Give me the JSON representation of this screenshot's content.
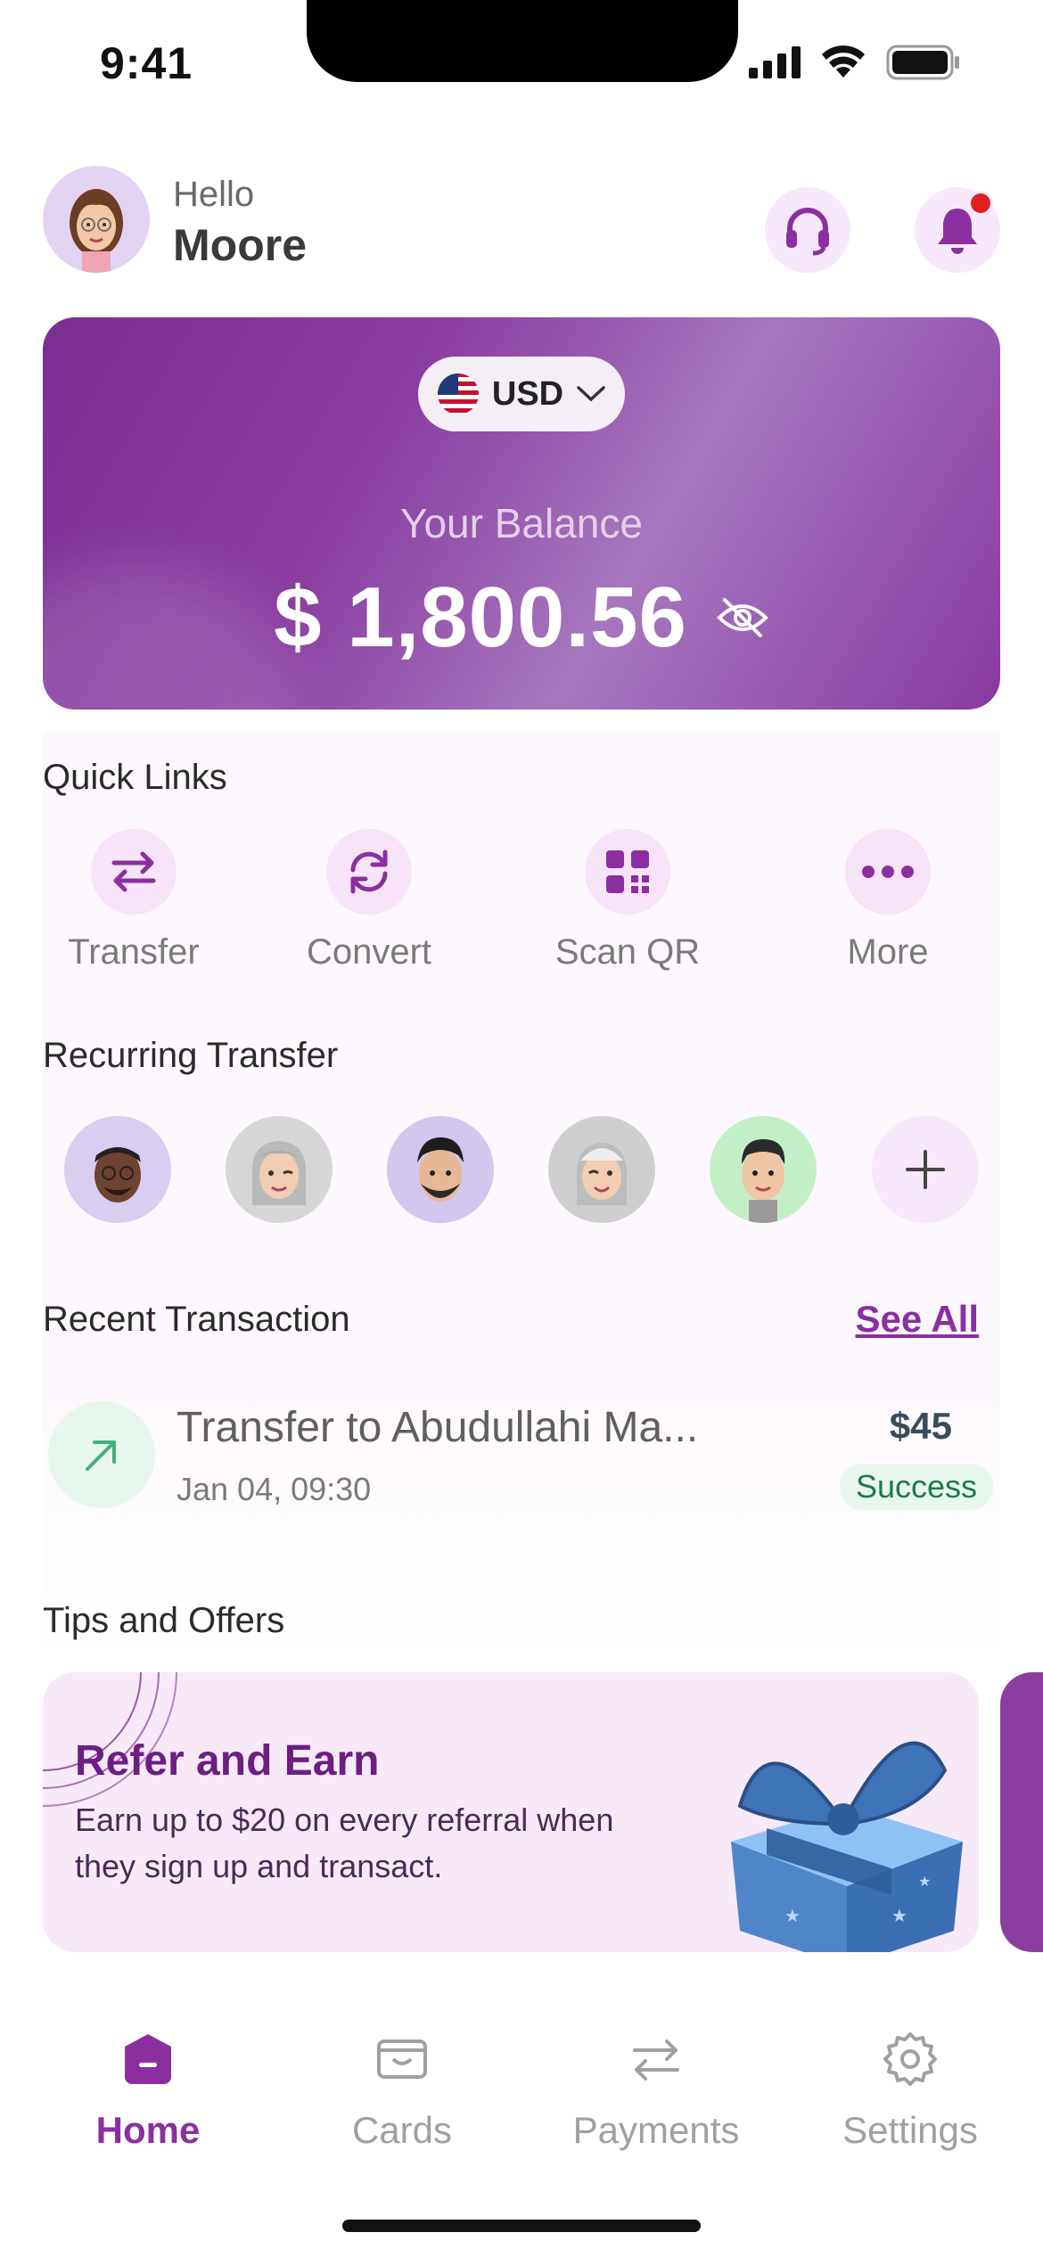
{
  "status_bar": {
    "time": "9:41"
  },
  "header": {
    "greeting": "Hello",
    "user_name": "Moore"
  },
  "balance_card": {
    "currency": "USD",
    "balance_label": "Your Balance",
    "balance_amount": "$ 1,800.56"
  },
  "quick_links": {
    "title": "Quick Links",
    "items": [
      {
        "label": "Transfer",
        "icon": "transfer-arrows-icon"
      },
      {
        "label": "Convert",
        "icon": "convert-refresh-icon"
      },
      {
        "label": "Scan QR",
        "icon": "qr-code-icon"
      },
      {
        "label": "More",
        "icon": "more-dots-icon"
      }
    ]
  },
  "recurring_transfer": {
    "title": "Recurring Transfer",
    "contacts": [
      {
        "icon": "contact-avatar",
        "bg": "#d9cdf1"
      },
      {
        "icon": "contact-avatar",
        "bg": "#d6d6d6"
      },
      {
        "icon": "contact-avatar",
        "bg": "#d2c7ee"
      },
      {
        "icon": "contact-avatar",
        "bg": "#cfcfcf"
      },
      {
        "icon": "contact-avatar",
        "bg": "#c3efc7"
      }
    ],
    "add_icon": "plus-icon"
  },
  "recent_transaction": {
    "title": "Recent Transaction",
    "see_all": "See All",
    "items": [
      {
        "title": "Transfer to Abudullahi Ma...",
        "date": "Jan 04, 09:30",
        "amount": "$45",
        "status": "Success"
      }
    ]
  },
  "tips": {
    "title": "Tips and Offers",
    "cards": [
      {
        "title": "Refer and Earn",
        "body": "Earn up to $20 on every referral when they sign up and transact."
      }
    ]
  },
  "tab_bar": {
    "items": [
      {
        "label": "Home",
        "active": true
      },
      {
        "label": "Cards",
        "active": false
      },
      {
        "label": "Payments",
        "active": false
      },
      {
        "label": "Settings",
        "active": false
      }
    ]
  },
  "colors": {
    "brand": "#8b2fa0",
    "success": "#1e7a4a",
    "accent_bg": "#f7e4f8"
  }
}
